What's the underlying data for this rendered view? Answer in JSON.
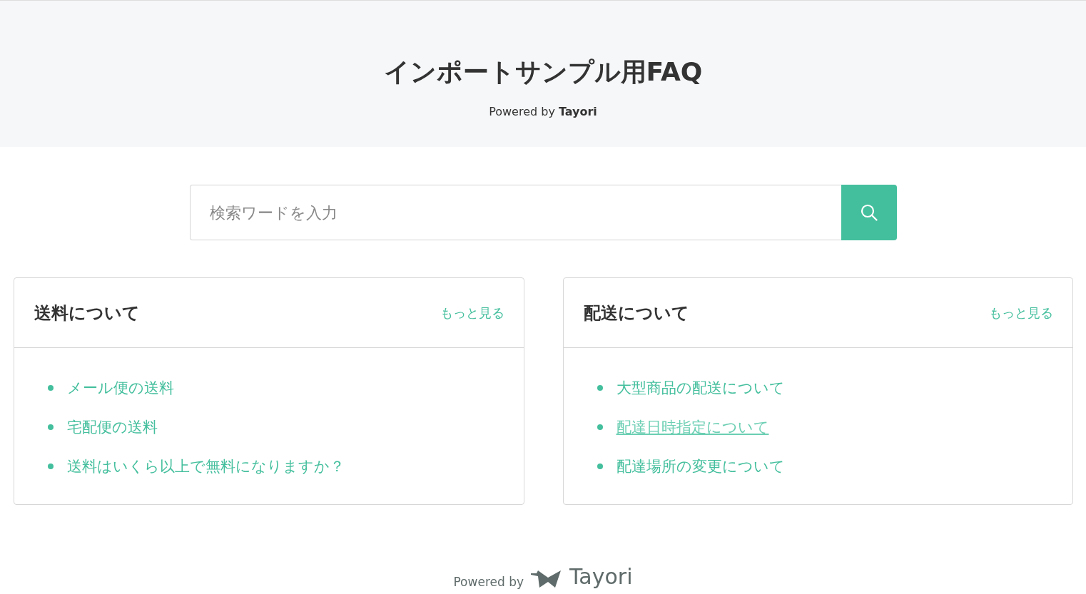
{
  "header": {
    "title": "インポートサンプル用FAQ",
    "powered_prefix": "Powered by",
    "powered_brand": "Tayori"
  },
  "search": {
    "placeholder": "検索ワードを入力"
  },
  "categories": [
    {
      "title": "送料について",
      "more": "もっと見る",
      "items": [
        {
          "label": "メール便の送料",
          "hovered": false
        },
        {
          "label": "宅配便の送料",
          "hovered": false
        },
        {
          "label": "送料はいくら以上で無料になりますか？",
          "hovered": false
        }
      ]
    },
    {
      "title": "配送について",
      "more": "もっと見る",
      "items": [
        {
          "label": "大型商品の配送について",
          "hovered": false
        },
        {
          "label": "配達日時指定について",
          "hovered": true
        },
        {
          "label": "配達場所の変更について",
          "hovered": false
        }
      ]
    }
  ],
  "footer": {
    "powered_prefix": "Powered by",
    "brand": "Tayori"
  }
}
